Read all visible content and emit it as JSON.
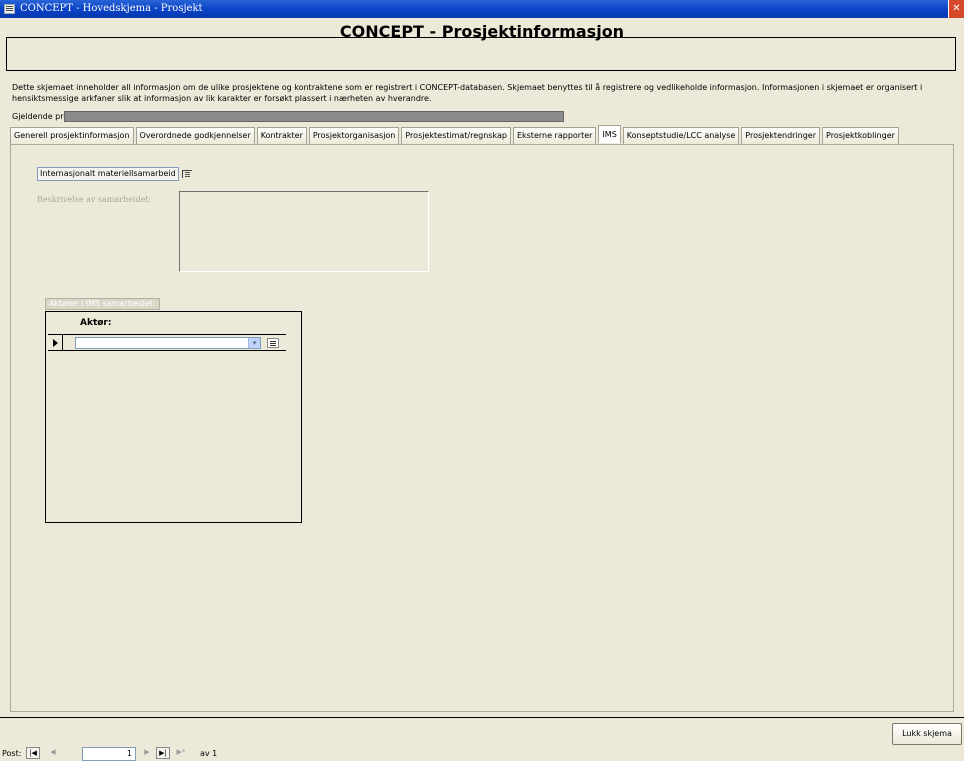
{
  "window": {
    "title": "CONCEPT - Hovedskjema - Prosjekt",
    "close_glyph": "✕"
  },
  "header": {
    "title": "CONCEPT - Prosjektinformasjon"
  },
  "description": "Dette skjemaet inneholder all informasjon om de ulike prosjektene og kontraktene som er registrert i CONCEPT-databasen. Skjemaet benyttes til å registrere og vedlikeholde informasjon. Informasjonen i skjemaet er organisert i hensiktsmessige arkfaner slik at informasjon av lik karakter er forsøkt plassert i nærheten av hverandre.",
  "current_project": {
    "label": "Gjeldende prosjekt:",
    "value": ""
  },
  "tabs": [
    {
      "label": "Generell prosjektinformasjon",
      "active": false
    },
    {
      "label": "Overordnede godkjennelser",
      "active": false
    },
    {
      "label": "Kontrakter",
      "active": false
    },
    {
      "label": "Prosjektorganisasjon",
      "active": false
    },
    {
      "label": "Prosjektestimat/regnskap",
      "active": false
    },
    {
      "label": "Eksterne rapporter",
      "active": false
    },
    {
      "label": "IMS",
      "active": true
    },
    {
      "label": "Konseptstudie/LCC analyse",
      "active": false
    },
    {
      "label": "Prosjektendringer",
      "active": false
    },
    {
      "label": "Prosjektkoblinger",
      "active": false
    }
  ],
  "ims": {
    "checkbox_label": "Internasjonalt materiellsamarbeid",
    "description_label": "Beskrivelse av samarbeidet:",
    "subform_label": "Aktører i IMS samarbeidet:",
    "column_header": "Aktør:",
    "combo_value": "",
    "combo_arrow": "▾"
  },
  "footer": {
    "close_button": "Lukk skjema"
  },
  "record_nav": {
    "label": "Post:",
    "first": "|◀",
    "prev": "◀",
    "current": "1",
    "next": "▶",
    "last": "▶|",
    "new": "▶*",
    "of_text": "av  1"
  }
}
